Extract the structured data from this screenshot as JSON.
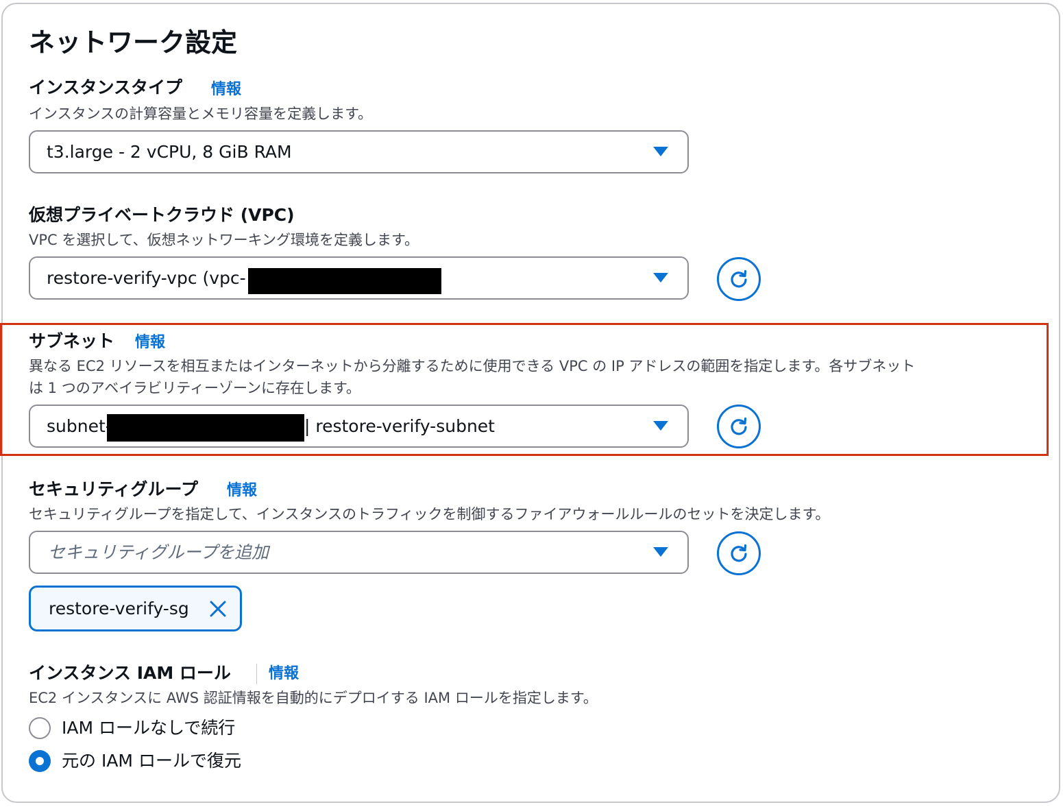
{
  "section": {
    "title": "ネットワーク設定"
  },
  "instance_type": {
    "label": "インスタンスタイプ",
    "info": "情報",
    "description": "インスタンスの計算容量とメモリ容量を定義します。",
    "value": "t3.large - 2 vCPU, 8 GiB RAM"
  },
  "vpc": {
    "label": "仮想プライベートクラウド (VPC)",
    "description": "VPC を選択して、仮想ネットワーキング環境を定義します。",
    "value": "restore-verify-vpc (vpc-"
  },
  "subnet": {
    "label": "サブネット",
    "info": "情報",
    "description_line1": "異なる EC2 リソースを相互またはインターネットから分離するために使用できる VPC の IP アドレスの範囲を指定します。各サブネット",
    "description_line2": "は 1 つのアベイラビリティーゾーンに存在します。",
    "value_prefix": "subnet-",
    "value_suffix": "| restore-verify-subnet"
  },
  "security_group": {
    "label": "セキュリティグループ",
    "info": "情報",
    "description": "セキュリティグループを指定して、インスタンスのトラフィックを制御するファイアウォールルールのセットを決定します。",
    "placeholder": "セキュリティグループを追加",
    "token": "restore-verify-sg"
  },
  "iam_role": {
    "label": "インスタンス IAM ロール",
    "info": "情報",
    "description": "EC2 インスタンスに AWS 認証情報を自動的にデプロイする IAM ロールを指定します。",
    "options": [
      {
        "label": "IAM ロールなしで続行",
        "selected": false
      },
      {
        "label": "元の IAM ロールで復元",
        "selected": true
      }
    ]
  },
  "colors": {
    "accent": "#0972d3",
    "highlight_border": "#d13212",
    "border": "#8c8c94",
    "token_bg": "#f2f8fd"
  }
}
